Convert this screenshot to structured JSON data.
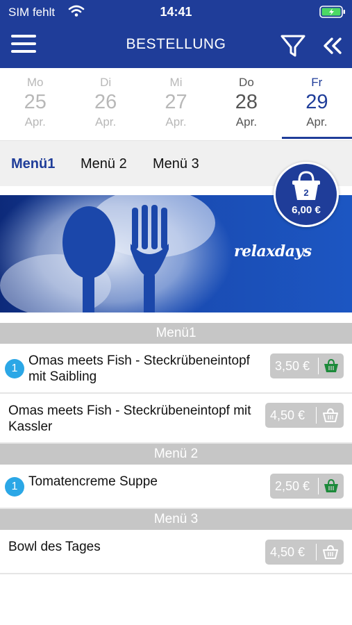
{
  "status": {
    "carrier": "SIM fehlt",
    "time": "14:41"
  },
  "header": {
    "title": "BESTELLUNG"
  },
  "days": [
    {
      "weekday": "Mo",
      "day": "25",
      "month": "Apr."
    },
    {
      "weekday": "Di",
      "day": "26",
      "month": "Apr."
    },
    {
      "weekday": "Mi",
      "day": "27",
      "month": "Apr."
    },
    {
      "weekday": "Do",
      "day": "28",
      "month": "Apr."
    },
    {
      "weekday": "Fr",
      "day": "29",
      "month": "Apr.",
      "selected": true
    }
  ],
  "tabs": [
    {
      "label": "Menü1",
      "active": true
    },
    {
      "label": "Menü 2"
    },
    {
      "label": "Menü 3"
    }
  ],
  "cart": {
    "count": "2",
    "total": "6,00 €"
  },
  "banner": {
    "brand": "relaxdays"
  },
  "menu": [
    {
      "section": "Menü1",
      "items": [
        {
          "qty": "1",
          "name": "Omas meets Fish - Steckrübeneintopf mit Saibling",
          "price": "3,50 €",
          "in_cart": true
        },
        {
          "qty": "",
          "name": "Omas meets Fish - Steckrübeneintopf mit Kassler",
          "price": "4,50 €",
          "in_cart": false
        }
      ]
    },
    {
      "section": "Menü 2",
      "items": [
        {
          "qty": "1",
          "name": "Tomatencreme Suppe",
          "price": "2,50 €",
          "in_cart": true
        }
      ]
    },
    {
      "section": "Menü 3",
      "items": [
        {
          "qty": "",
          "name": "Bowl des Tages",
          "price": "4,50 €",
          "in_cart": false
        }
      ]
    }
  ],
  "colors": {
    "primary": "#1f3d99",
    "badge": "#2ba7e6",
    "basket_active": "#1c8a3a",
    "section": "#c6c6c6"
  },
  "icons": [
    "wifi-icon",
    "battery-icon",
    "menu-icon",
    "filter-icon",
    "double-chevron-left-icon",
    "basket-icon"
  ]
}
